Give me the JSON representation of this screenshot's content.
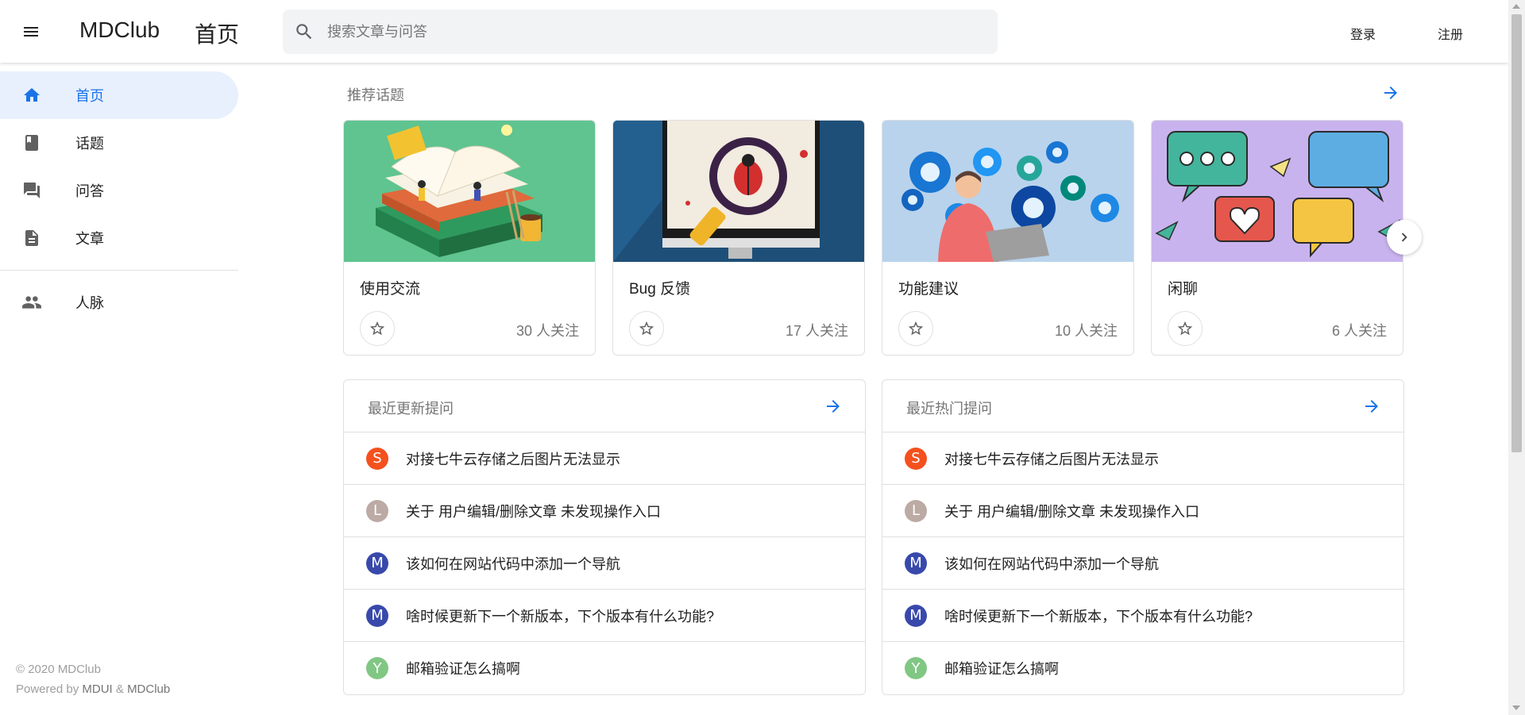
{
  "appbar": {
    "app_name": "MDClub",
    "page_title": "首页",
    "search_placeholder": "搜索文章与问答",
    "login_label": "登录",
    "register_label": "注册"
  },
  "drawer": {
    "items": [
      {
        "label": "首页",
        "icon": "home-icon",
        "active": true
      },
      {
        "label": "话题",
        "icon": "book-icon",
        "active": false
      },
      {
        "label": "问答",
        "icon": "forum-icon",
        "active": false
      },
      {
        "label": "文章",
        "icon": "article-icon",
        "active": false
      },
      {
        "label": "人脉",
        "icon": "people-icon",
        "active": false
      }
    ],
    "copyright_line": "© 2020 MDClub",
    "powered_prefix": "Powered by ",
    "powered_link1": "MDUI",
    "powered_amp": " & ",
    "powered_link2": "MDClub"
  },
  "topics": {
    "title": "推荐话题",
    "cards": [
      {
        "name": "使用交流",
        "followers": "30 人关注"
      },
      {
        "name": "Bug 反馈",
        "followers": "17 人关注"
      },
      {
        "name": "功能建议",
        "followers": "10 人关注"
      },
      {
        "name": "闲聊",
        "followers": "6 人关注"
      }
    ]
  },
  "recent_questions": {
    "title": "最近更新提问",
    "items": [
      {
        "avatar": "S",
        "avatar_color": "#f4511e",
        "text": "对接七牛云存储之后图片无法显示"
      },
      {
        "avatar": "L",
        "avatar_color": "#bcaaa4",
        "text": "关于 用户编辑/删除文章 未发现操作入口"
      },
      {
        "avatar": "M",
        "avatar_color": "#3949ab",
        "text": "该如何在网站代码中添加一个导航"
      },
      {
        "avatar": "M",
        "avatar_color": "#3949ab",
        "text": "啥时候更新下一个新版本，下个版本有什么功能?"
      },
      {
        "avatar": "Y",
        "avatar_color": "#81c784",
        "text": "邮箱验证怎么搞啊"
      }
    ]
  },
  "hot_questions": {
    "title": "最近热门提问",
    "items": [
      {
        "avatar": "S",
        "avatar_color": "#f4511e",
        "text": "对接七牛云存储之后图片无法显示"
      },
      {
        "avatar": "L",
        "avatar_color": "#bcaaa4",
        "text": "关于 用户编辑/删除文章 未发现操作入口"
      },
      {
        "avatar": "M",
        "avatar_color": "#3949ab",
        "text": "该如何在网站代码中添加一个导航"
      },
      {
        "avatar": "M",
        "avatar_color": "#3949ab",
        "text": "啥时候更新下一个新版本，下个版本有什么功能?"
      },
      {
        "avatar": "Y",
        "avatar_color": "#81c784",
        "text": "邮箱验证怎么搞啊"
      }
    ]
  },
  "colors": {
    "accent": "#1a73e8",
    "active_nav_bg": "#e8f0fe"
  }
}
